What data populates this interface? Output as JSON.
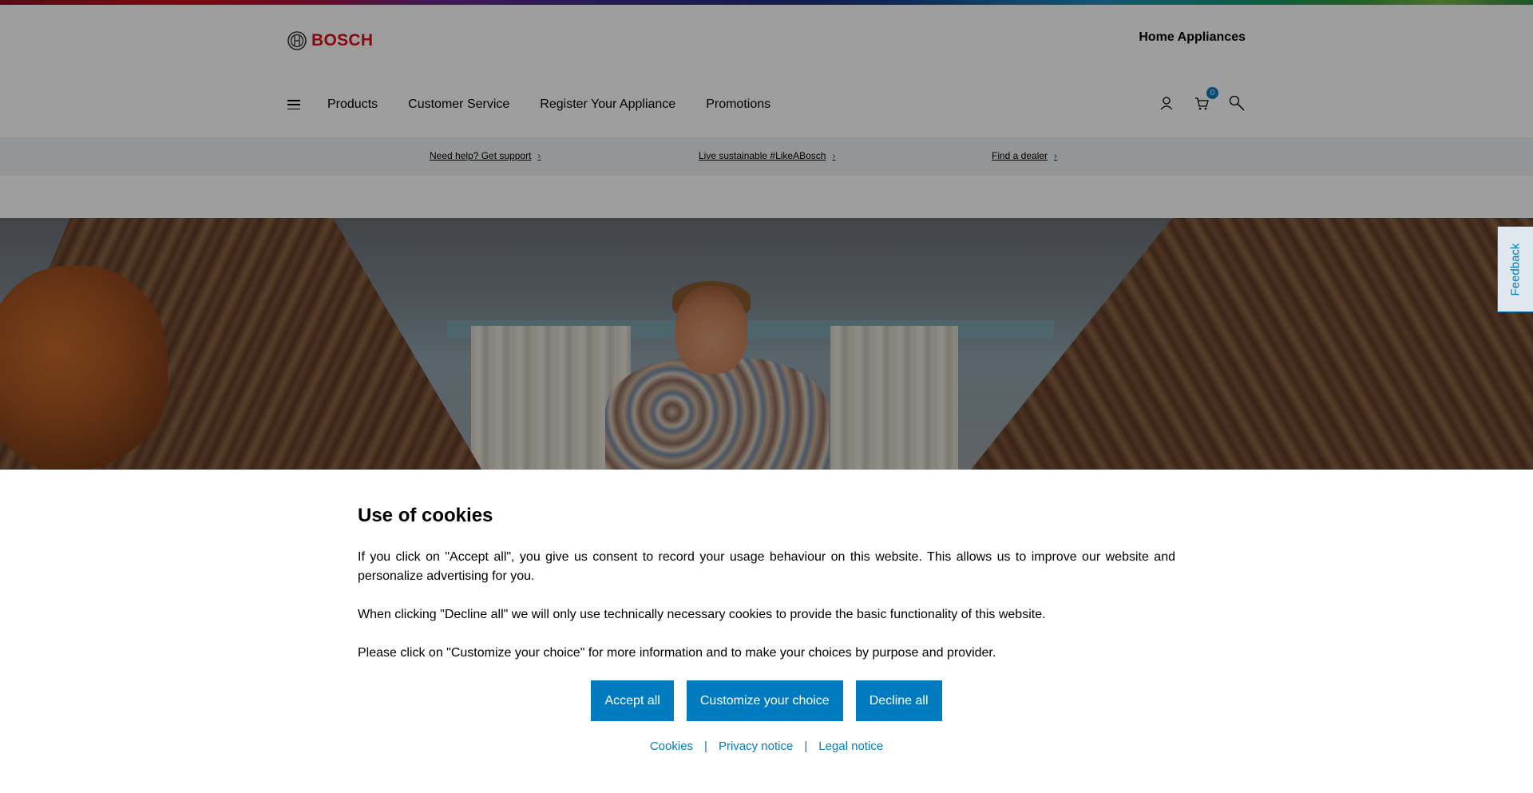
{
  "header": {
    "brand": "BOSCH",
    "section_title": "Home Appliances",
    "nav": [
      "Products",
      "Customer Service",
      "Register Your Appliance",
      "Promotions"
    ],
    "cart_count": "0"
  },
  "subbar": {
    "links": [
      "Need help? Get support",
      "Live sustainable #LikeABosch",
      "Find a dealer"
    ]
  },
  "feedback_label": "Feedback",
  "cookie": {
    "title": "Use of cookies",
    "paragraphs": [
      "If you click on \"Accept all\", you give us consent to record your usage behaviour on this website. This allows us to improve our website and personalize advertising for you.",
      "When clicking \"Decline all\" we will only use technically necessary cookies to provide the basic functionality of this website.",
      "Please click on \"Customize your choice\" for more information and to make your choices by purpose and provider."
    ],
    "buttons": [
      "Accept all",
      "Customize your choice",
      "Decline all"
    ],
    "links": [
      "Cookies",
      "Privacy notice",
      "Legal notice"
    ],
    "separator": "|"
  },
  "colors": {
    "brand_red": "#d8111c",
    "accent_blue": "#007bc0"
  },
  "icons": [
    "bosch-logo-icon",
    "menu-icon",
    "user-icon",
    "cart-icon",
    "search-icon",
    "chevron-right-icon"
  ]
}
